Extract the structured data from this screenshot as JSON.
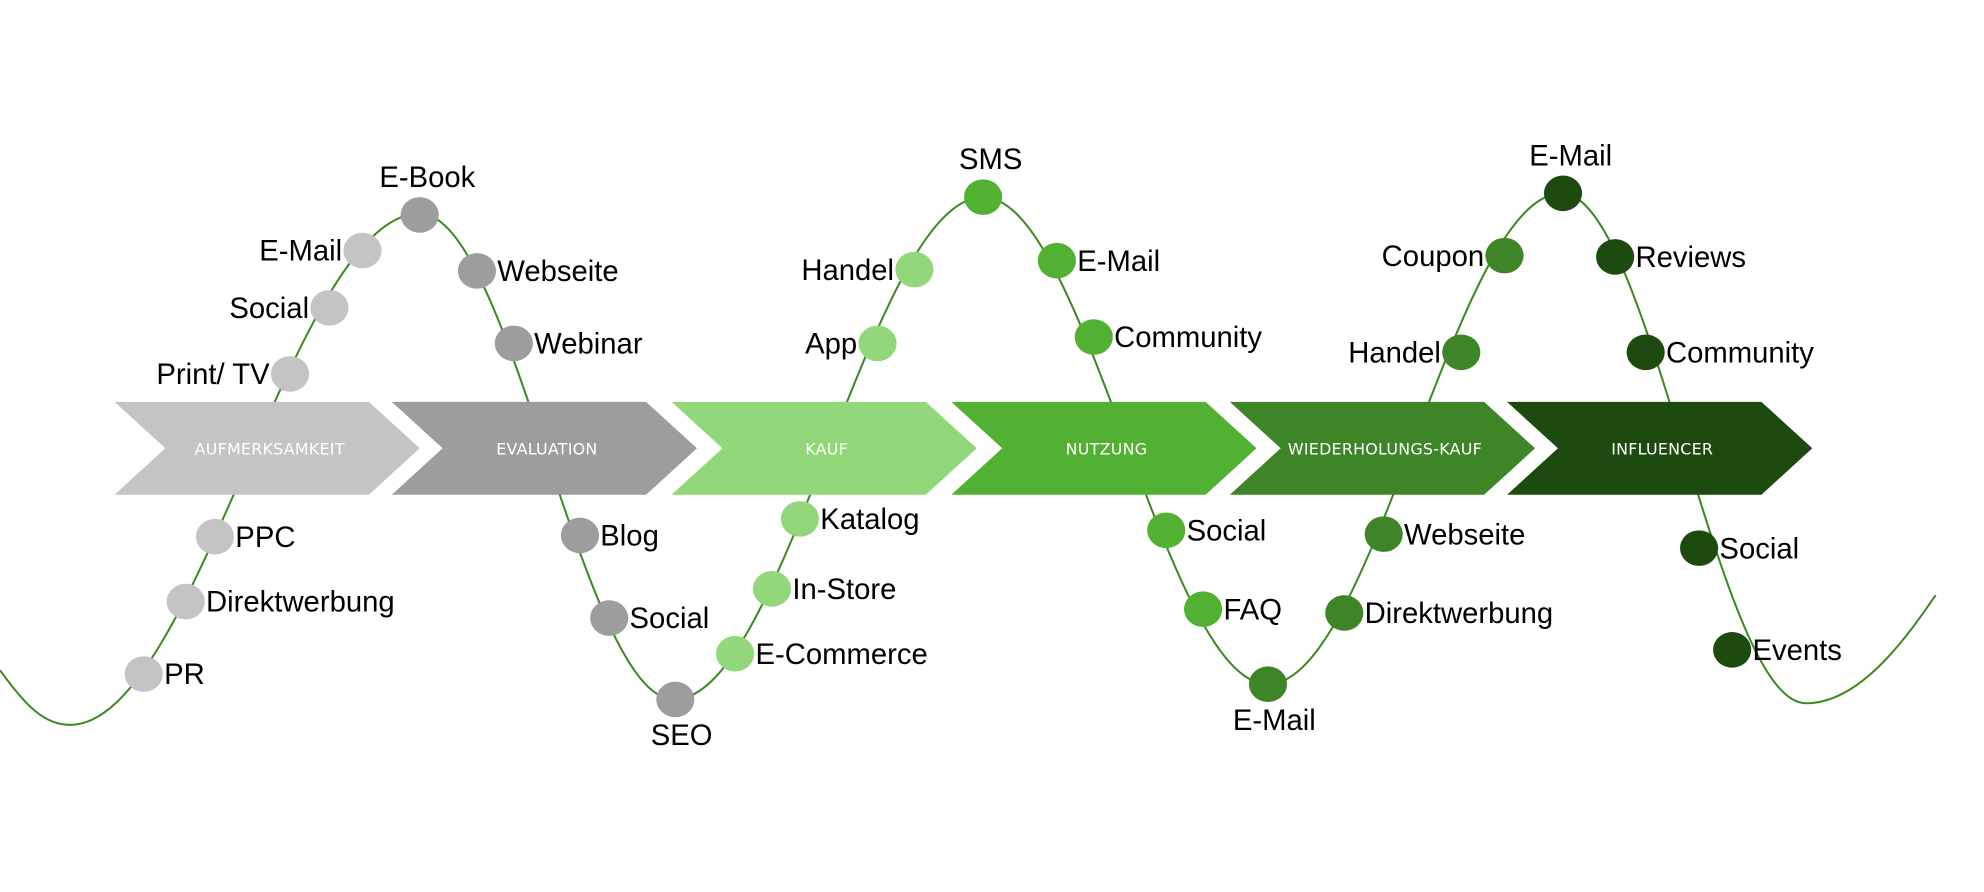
{
  "stages": [
    {
      "label": "AUFMERKSAMKEIT",
      "color": "#c4c4c4"
    },
    {
      "label": "EVALUATION",
      "color": "#9d9d9d"
    },
    {
      "label": "KAUF",
      "color": "#92d77a"
    },
    {
      "label": "NUTZUNG",
      "color": "#52b033"
    },
    {
      "label": "WIEDERHOLUNGS-KAUF",
      "color": "#3d8527"
    },
    {
      "label": "INFLUENCER",
      "color": "#1d4a0f"
    }
  ],
  "curve_color": "#3e8a22",
  "touchpoints": [
    {
      "label": "Print/ TV",
      "stage": 0
    },
    {
      "label": "Social",
      "stage": 0
    },
    {
      "label": "E-Mail",
      "stage": 0
    },
    {
      "label": "PPC",
      "stage": 0
    },
    {
      "label": "Direktwerbung",
      "stage": 0
    },
    {
      "label": "PR",
      "stage": 0
    },
    {
      "label": "E-Book",
      "stage": 1
    },
    {
      "label": "Webseite",
      "stage": 1
    },
    {
      "label": "Webinar",
      "stage": 1
    },
    {
      "label": "Blog",
      "stage": 1
    },
    {
      "label": "Social",
      "stage": 1
    },
    {
      "label": "SEO",
      "stage": 1
    },
    {
      "label": "Handel",
      "stage": 2
    },
    {
      "label": "App",
      "stage": 2
    },
    {
      "label": "Katalog",
      "stage": 2
    },
    {
      "label": "In-Store",
      "stage": 2
    },
    {
      "label": "E-Commerce",
      "stage": 2
    },
    {
      "label": "SMS",
      "stage": 3
    },
    {
      "label": "E-Mail",
      "stage": 3
    },
    {
      "label": "Community",
      "stage": 3
    },
    {
      "label": "Social",
      "stage": 3
    },
    {
      "label": "FAQ",
      "stage": 3
    },
    {
      "label": "E-Mail",
      "stage": 4
    },
    {
      "label": "Webseite",
      "stage": 4
    },
    {
      "label": "Direktwerbung",
      "stage": 4
    },
    {
      "label": "Coupon",
      "stage": 4
    },
    {
      "label": "Handel",
      "stage": 4
    },
    {
      "label": "E-Mail",
      "stage": 5
    },
    {
      "label": "Reviews",
      "stage": 5
    },
    {
      "label": "Community",
      "stage": 5
    },
    {
      "label": "Social",
      "stage": 5
    },
    {
      "label": "Events",
      "stage": 5
    }
  ]
}
